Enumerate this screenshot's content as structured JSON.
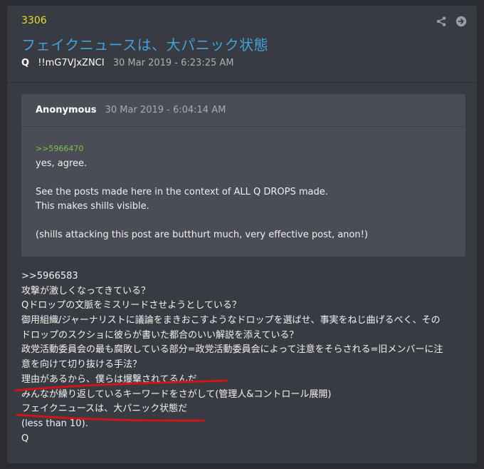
{
  "post": {
    "number": "3306",
    "title": "フェイクニュースは、大パニック状態",
    "author": "Q",
    "tripcode": "!!mG7VJxZNCI",
    "date": "30 Mar 2019 - 6:23:25 AM"
  },
  "quote": {
    "author": "Anonymous",
    "date": "30 Mar 2019 - 6:04:14 AM",
    "ref": ">>5966470",
    "lines": [
      "yes, agree.",
      "",
      "See the posts made here in the context of ALL Q DROPS made.",
      "This makes shills visible.",
      "",
      "(shills attacking this post are butthurt much, very effective post, anon!)"
    ]
  },
  "body": {
    "lines": [
      ">>5966583",
      "攻撃が激しくなってきている？",
      "Qドロップの文脈をミスリードさせようとしている？",
      "御用組織/ジャーナリストに議論をまきおこすようなドロップを選ばせ、事実をねじ曲げるべく、その",
      "ドロップのスクショに彼らが書いた都合のいい解説を添えている？",
      "政党活動委員会の最も腐敗している部分=政党活動委員会によって注意をそらされる=旧メンバーに注",
      "意を向けて切り抜ける手法？",
      "理由があるから、僕らは爆撃されてるんだ",
      "みんなが繰り返しているキーワードをさがして(管理人&コントロール展開)",
      "フェイクニュースは、大パニック状態だ",
      "(less than 10).",
      "Q"
    ]
  },
  "icons": [
    "share-icon",
    "arrow-right-circle-icon"
  ],
  "colors": {
    "background": "#2a2c32",
    "card": "#383b42",
    "quote_box": "#4a4d55",
    "post_number": "#e9de2a",
    "title": "#41a3d8",
    "ref_link": "#7ec24a",
    "annotation": "#d0141a"
  }
}
